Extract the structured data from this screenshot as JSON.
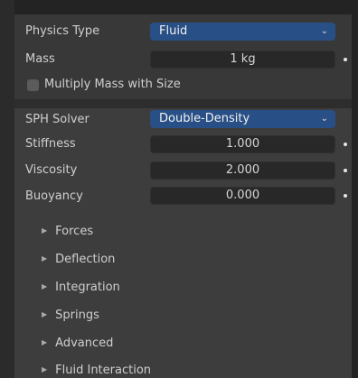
{
  "physics_type": {
    "label": "Physics Type",
    "value": "Fluid"
  },
  "mass": {
    "label": "Mass",
    "value": "1 kg"
  },
  "multiply_mass_with_size": {
    "label": "Multiply Mass with Size",
    "checked": false
  },
  "sph_solver": {
    "label": "SPH Solver",
    "value": "Double-Density"
  },
  "stiffness": {
    "label": "Stiffness",
    "value": "1.000"
  },
  "viscosity": {
    "label": "Viscosity",
    "value": "2.000"
  },
  "buoyancy": {
    "label": "Buoyancy",
    "value": "0.000"
  },
  "sections": [
    {
      "label": "Forces"
    },
    {
      "label": "Deflection"
    },
    {
      "label": "Integration"
    },
    {
      "label": "Springs"
    },
    {
      "label": "Advanced"
    },
    {
      "label": "Fluid Interaction"
    }
  ],
  "icons": {
    "dropdown": "chevron-down-icon",
    "collapsed": "triangle-right-icon",
    "keyframe": "keyframe-dot-icon"
  },
  "colors": {
    "accent": "#284f86",
    "panel": "#3d3d3d",
    "field": "#282828"
  }
}
